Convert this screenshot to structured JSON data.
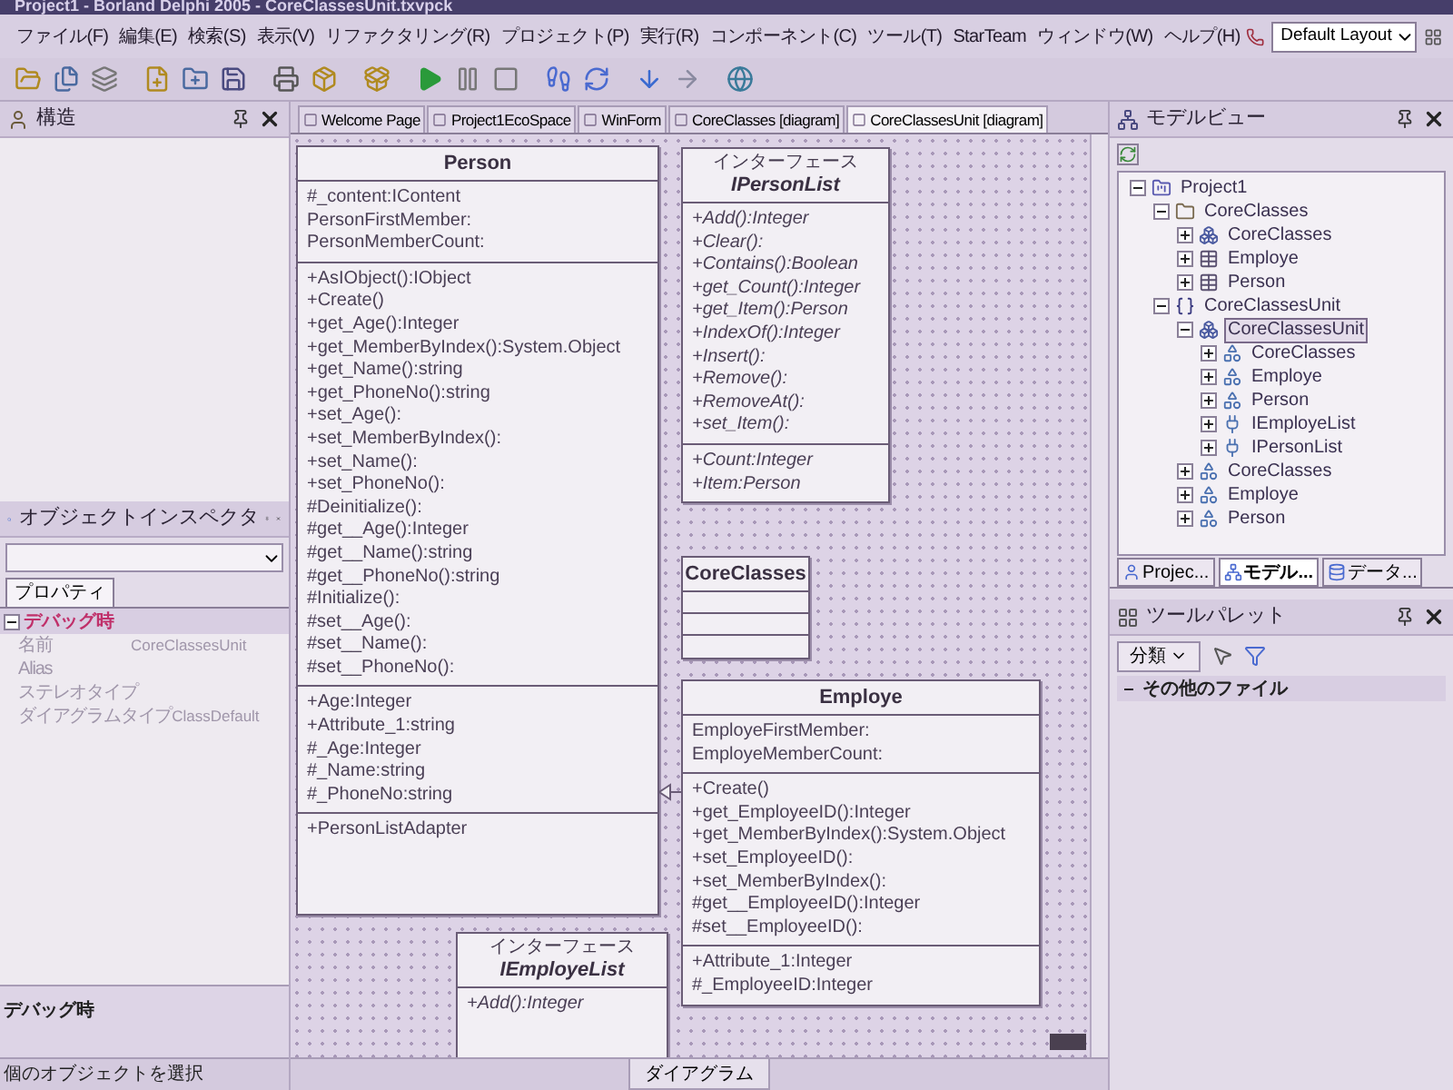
{
  "window": {
    "title": "Project1 - Borland Delphi 2005 - CoreClassesUnit.txvpck"
  },
  "menu": [
    "ファイル(F)",
    "編集(E)",
    "検索(S)",
    "表示(V)",
    "リファクタリング(R)",
    "プロジェクト(P)",
    "実行(R)",
    "コンポーネント(C)",
    "ツール(T)",
    "StarTeam",
    "ウィンドウ(W)",
    "ヘルプ(H)"
  ],
  "layout_selector": {
    "value": "Default Layout"
  },
  "structure_panel": {
    "title": "構造"
  },
  "object_inspector": {
    "title": "オブジェクトインスペクタ",
    "tabs": [
      {
        "label": "プロパティ",
        "selected": true
      }
    ],
    "category": {
      "label": "デバッグ時",
      "expanded": true
    },
    "properties": [
      {
        "name": "名前",
        "value": "CoreClassesUnit",
        "disabled": true
      },
      {
        "name": "Alias",
        "disabled": true
      },
      {
        "name": "ステレオタイプ",
        "disabled": true
      },
      {
        "name": "ダイアグラムタイプ",
        "value": "ClassDefault",
        "disabled": true
      }
    ],
    "description": "デバッグ時"
  },
  "document_tabs": [
    {
      "label": "Welcome Page",
      "selected": false
    },
    {
      "label": "Project1EcoSpace",
      "selected": false
    },
    {
      "label": "WinForm",
      "selected": false
    },
    {
      "label": "CoreClasses [diagram]",
      "selected": false
    },
    {
      "label": "CoreClassesUnit [diagram]",
      "selected": true
    }
  ],
  "diagram": {
    "classes": [
      {
        "kind": "class",
        "name": "Person",
        "sections": [
          [
            "#_content:IContent",
            "PersonFirstMember:",
            "PersonMemberCount:"
          ],
          [
            "+AsIObject():IObject",
            "+Create()",
            "+get_Age():Integer",
            "+get_MemberByIndex():System.Object",
            "+get_Name():string",
            "+get_PhoneNo():string",
            "+set_Age():",
            "+set_MemberByIndex():",
            "+set_Name():",
            "+set_PhoneNo():",
            "#Deinitialize():",
            "#get__Age():Integer",
            "#get__Name():string",
            "#get__PhoneNo():string",
            "#Initialize():",
            "#set__Age():",
            "#set__Name():",
            "#set__PhoneNo():"
          ],
          [
            "+Age:Integer",
            "+Attribute_1:string",
            "#_Age:Integer",
            "#_Name:string",
            "#_PhoneNo:string"
          ],
          [
            "+PersonListAdapter"
          ]
        ]
      },
      {
        "kind": "interface",
        "stereotype": "インターフェース",
        "name": "IPersonList",
        "sections": [
          [
            "+Add():Integer",
            "+Clear():",
            "+Contains():Boolean",
            "+get_Count():Integer",
            "+get_Item():Person",
            "+IndexOf():Integer",
            "+Insert():",
            "+Remove():",
            "+RemoveAt():",
            "+set_Item():"
          ],
          [
            "+Count:Integer",
            "+Item:Person"
          ]
        ]
      },
      {
        "kind": "empty_class",
        "name": "CoreClasses"
      },
      {
        "kind": "class",
        "name": "Employe",
        "sections": [
          [
            "EmployeFirstMember:",
            "EmployeMemberCount:"
          ],
          [
            "+Create()",
            "+get_EmployeeID():Integer",
            "+get_MemberByIndex():System.Object",
            "+set_EmployeeID():",
            "+set_MemberByIndex():",
            "#get__EmployeeID():Integer",
            "#set__EmployeeID():"
          ],
          [
            "+Attribute_1:Integer",
            "#_EmployeeID:Integer"
          ]
        ]
      },
      {
        "kind": "interface",
        "stereotype": "インターフェース",
        "name": "IEmployeList",
        "sections": [
          [
            "+Add():Integer"
          ]
        ]
      }
    ],
    "bottom_tab": "ダイアグラム"
  },
  "model_view": {
    "title": "モデルビュー",
    "tree": [
      {
        "kind": "project",
        "label": "Project1",
        "expanded": true,
        "selected": false,
        "children": [
          {
            "kind": "folder",
            "label": "CoreClasses",
            "expanded": true,
            "selected": false,
            "children": [
              {
                "kind": "package",
                "label": "CoreClasses",
                "expanded": false,
                "selected": false
              },
              {
                "kind": "class",
                "label": "Employe",
                "expanded": false,
                "selected": false
              },
              {
                "kind": "class",
                "label": "Person",
                "expanded": false,
                "selected": false
              }
            ]
          },
          {
            "kind": "namespace",
            "label": "CoreClassesUnit",
            "expanded": true,
            "selected": false,
            "children": [
              {
                "kind": "package",
                "label": "CoreClassesUnit",
                "expanded": true,
                "selected": true,
                "children": [
                  {
                    "kind": "type",
                    "label": "CoreClasses",
                    "expanded": false,
                    "selected": false
                  },
                  {
                    "kind": "type",
                    "label": "Employe",
                    "expanded": false,
                    "selected": false
                  },
                  {
                    "kind": "type",
                    "label": "Person",
                    "expanded": false,
                    "selected": false
                  },
                  {
                    "kind": "interface",
                    "label": "IEmployeList",
                    "expanded": false,
                    "selected": false
                  },
                  {
                    "kind": "interface",
                    "label": "IPersonList",
                    "expanded": false,
                    "selected": false
                  }
                ]
              },
              {
                "kind": "type",
                "label": "CoreClasses",
                "expanded": false,
                "selected": false
              },
              {
                "kind": "type",
                "label": "Employe",
                "expanded": false,
                "selected": false
              },
              {
                "kind": "type",
                "label": "Person",
                "expanded": false,
                "selected": false
              }
            ]
          }
        ]
      }
    ]
  },
  "side_tabs": [
    {
      "kind": "project",
      "label": "Projec...",
      "selected": false
    },
    {
      "kind": "model",
      "label": "モデル...",
      "selected": true
    },
    {
      "kind": "data",
      "label": "データ...",
      "selected": false
    }
  ],
  "tool_palette": {
    "title": "ツールパレット",
    "category_button": "分類",
    "group": {
      "label": "その他のファイル",
      "expanded": true
    }
  },
  "status_bar": "個のオブジェクトを選択"
}
